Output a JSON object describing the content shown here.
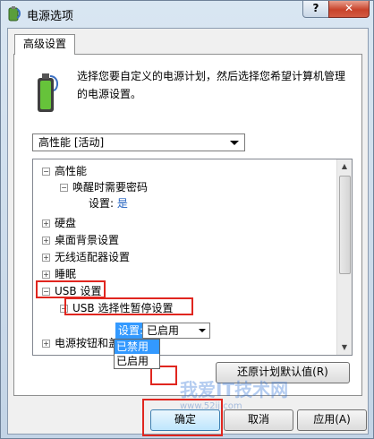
{
  "window": {
    "title": "电源选项",
    "help_label": "?",
    "close_label": "✕"
  },
  "tabs": [
    {
      "label": "高级设置"
    }
  ],
  "description": "选择您要自定义的电源计划，然后选择您希望计算机管理的电源设置。",
  "plan_select": {
    "value": "高性能 [活动]"
  },
  "tree": {
    "nodes": [
      {
        "label": "高性能",
        "expander": "−"
      },
      {
        "label": "唤醒时需要密码",
        "expander": "−"
      },
      {
        "setting_label": "设置:",
        "setting_value": "是"
      },
      {
        "label": "硬盘",
        "expander": "+"
      },
      {
        "label": "桌面背景设置",
        "expander": "+"
      },
      {
        "label": "无线适配器设置",
        "expander": "+"
      },
      {
        "label": "睡眠",
        "expander": "+"
      },
      {
        "label": "USB 设置",
        "expander": "−"
      },
      {
        "label": "USB 选择性暂停设置",
        "expander": "−"
      },
      {
        "label": "电源按钮和盖",
        "expander": "+"
      }
    ]
  },
  "usb_setting": {
    "label": "设置:",
    "value": "已启用",
    "options": [
      "已禁用",
      "已启用"
    ],
    "highlighted_option": "已禁用"
  },
  "buttons": {
    "restore": "还原计划默认值(R)",
    "ok": "确定",
    "cancel": "取消",
    "apply": "应用(A)"
  },
  "watermark": {
    "text": "我爱IT技术网",
    "url": "www.52ij.com"
  },
  "colors": {
    "highlight_box": "#e0261f",
    "selection": "#3399ff",
    "setting_value": "#1f5fbf"
  }
}
